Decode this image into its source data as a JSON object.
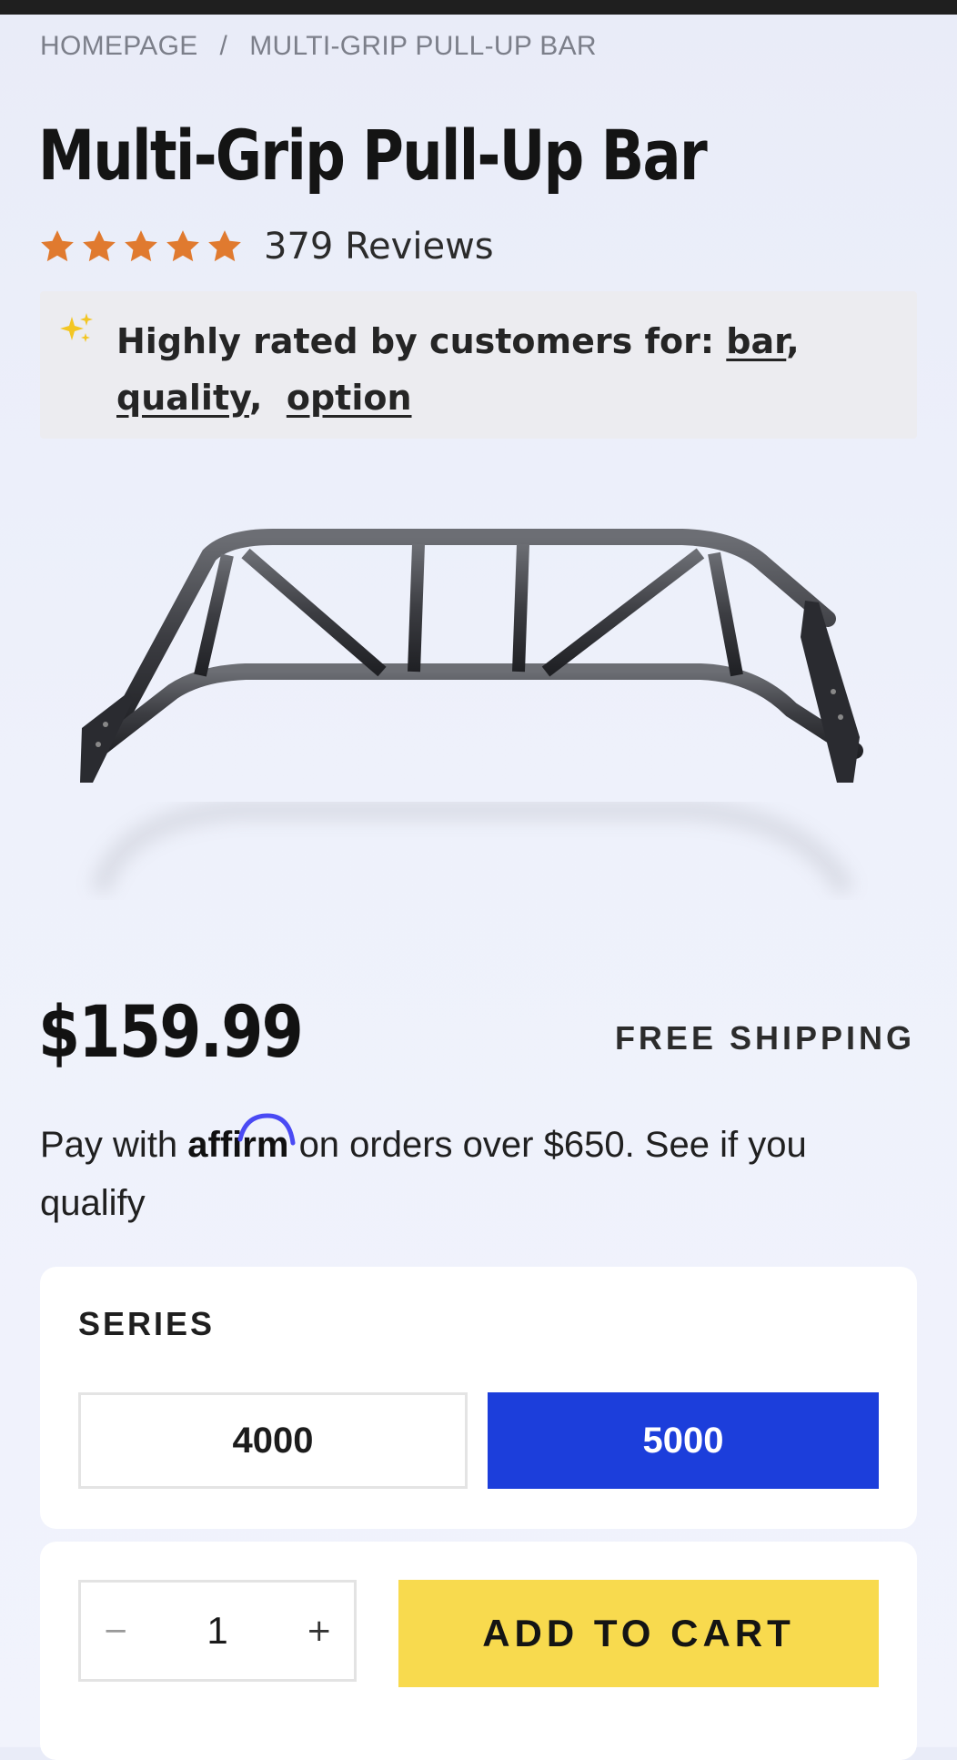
{
  "breadcrumb": {
    "home": "HOMEPAGE",
    "separator": "/",
    "current": "MULTI-GRIP PULL-UP BAR"
  },
  "product": {
    "title": "Multi-Grip Pull-Up Bar",
    "rating": 5,
    "reviews_label": "379 Reviews",
    "price": "$159.99",
    "shipping": "FREE SHIPPING"
  },
  "highlights": {
    "prefix": "Highly rated by customers for:",
    "tags": [
      "bar",
      "quality",
      "option"
    ],
    "sparkle_icon": "sparkle-icon"
  },
  "affirm": {
    "pay_with": "Pay with",
    "logo": "affirm",
    "rest": "on orders over $650. See if you qualify"
  },
  "series": {
    "label": "SERIES",
    "options": [
      "4000",
      "5000"
    ],
    "selected": "5000"
  },
  "cart": {
    "quantity": "1",
    "minus": "−",
    "plus": "+",
    "add_label": "ADD TO CART"
  },
  "colors": {
    "star": "#e07a2f",
    "series_selected": "#1c3edb",
    "add_to_cart": "#f8da4e",
    "affirm_arc": "#4a4af4"
  }
}
